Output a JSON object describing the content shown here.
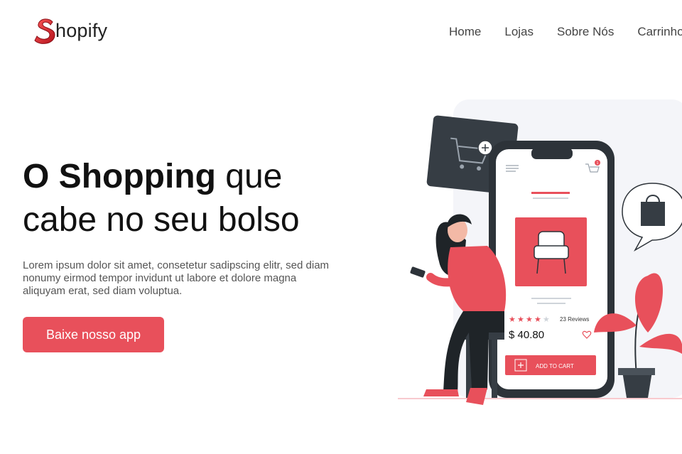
{
  "brand": {
    "logo_letter": "S",
    "name_rest": "hopify",
    "accent": "#e8505b"
  },
  "nav": {
    "items": [
      "Home",
      "Lojas",
      "Sobre Nós",
      "Carrinho"
    ]
  },
  "hero": {
    "title_bold": "O Shopping",
    "title_rest": " que",
    "title_line2": "cabe no seu bolso",
    "text": "Lorem ipsum dolor sit amet, consetetur sadipscing elitr, sed diam nonumy eirmod tempor invidunt ut labore et dolore magna aliquyam erat, sed diam voluptua.",
    "cta_label": "Baixe nosso app"
  },
  "phone": {
    "reviews": "23 Reviews",
    "rating": 4,
    "rating_max": 5,
    "price": "$ 40.80",
    "add_to_cart": "ADD TO CART",
    "cart_badge": "1"
  }
}
